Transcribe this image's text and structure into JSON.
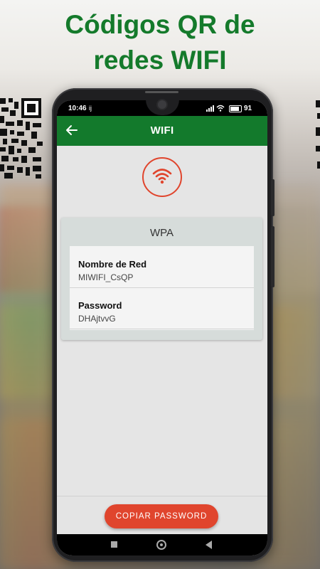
{
  "headline": {
    "line1": "Códigos QR de",
    "line2": "redes WIFI"
  },
  "statusbar": {
    "time": "10:46",
    "extra": "ij",
    "battery": "91"
  },
  "appbar": {
    "title": "WIFI",
    "back_icon": "arrow-left-icon"
  },
  "network": {
    "security_type": "WPA",
    "name_label": "Nombre de Red",
    "name_value": "MIWIFI_CsQP",
    "password_label": "Password",
    "password_value": "DHAjtvvG"
  },
  "actions": {
    "copy_password": "COPIAR PASSWORD"
  },
  "colors": {
    "brand_green": "#137a2c",
    "accent_red": "#e0452d"
  }
}
